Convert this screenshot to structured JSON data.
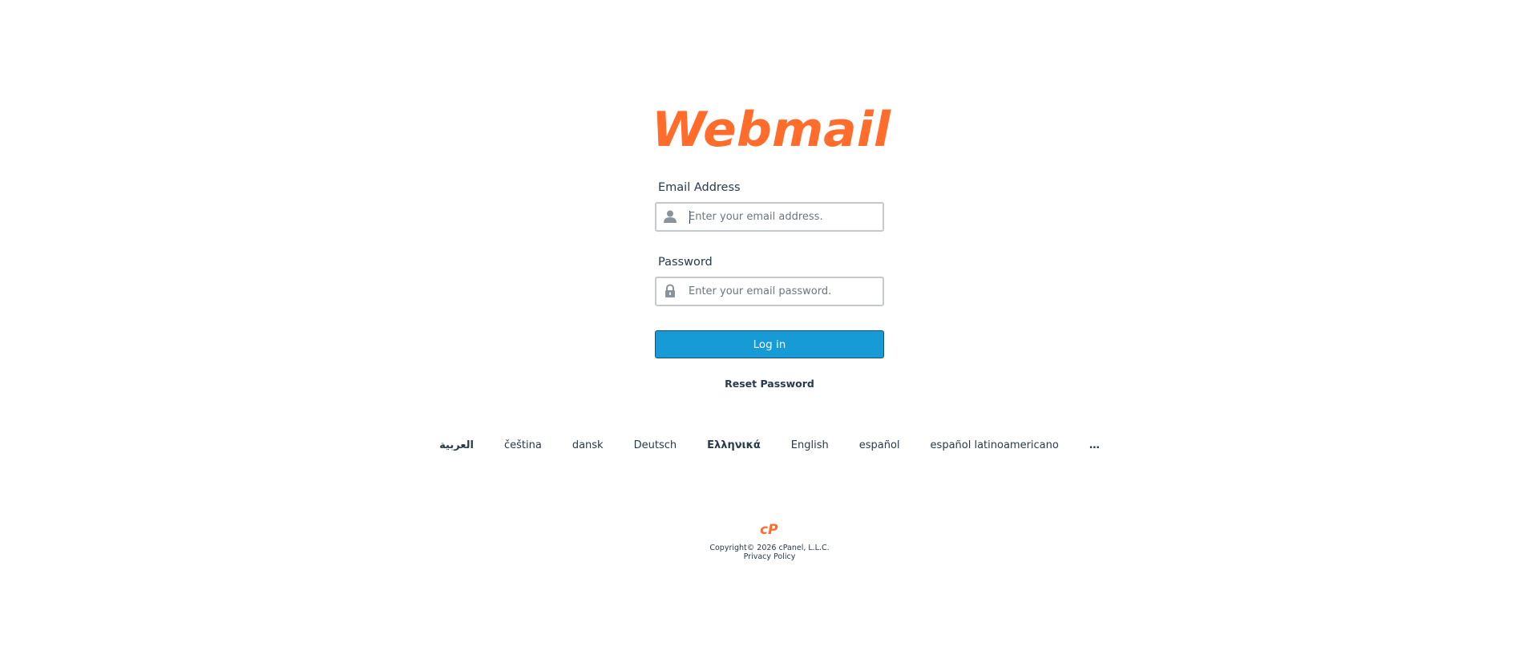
{
  "brand": {
    "logo_text": "Webmail",
    "logo_color": "#ff6c2c"
  },
  "form": {
    "email_label": "Email Address",
    "email_placeholder": "Enter your email address.",
    "email_value": "",
    "email_icon": "user-icon",
    "password_label": "Password",
    "password_placeholder": "Enter your email password.",
    "password_value": "",
    "password_icon": "lock-icon",
    "login_label": "Log in",
    "login_color": "#179bd7",
    "reset_label": "Reset Password"
  },
  "languages": [
    "العربية",
    "čeština",
    "dansk",
    "Deutsch",
    "Ελληνικά",
    "English",
    "español",
    "español latinoamericano",
    "…"
  ],
  "footer": {
    "logo_text": "cP",
    "copyright": "Copyright© 2026 cPanel, L.L.C.",
    "privacy": "Privacy Policy"
  }
}
